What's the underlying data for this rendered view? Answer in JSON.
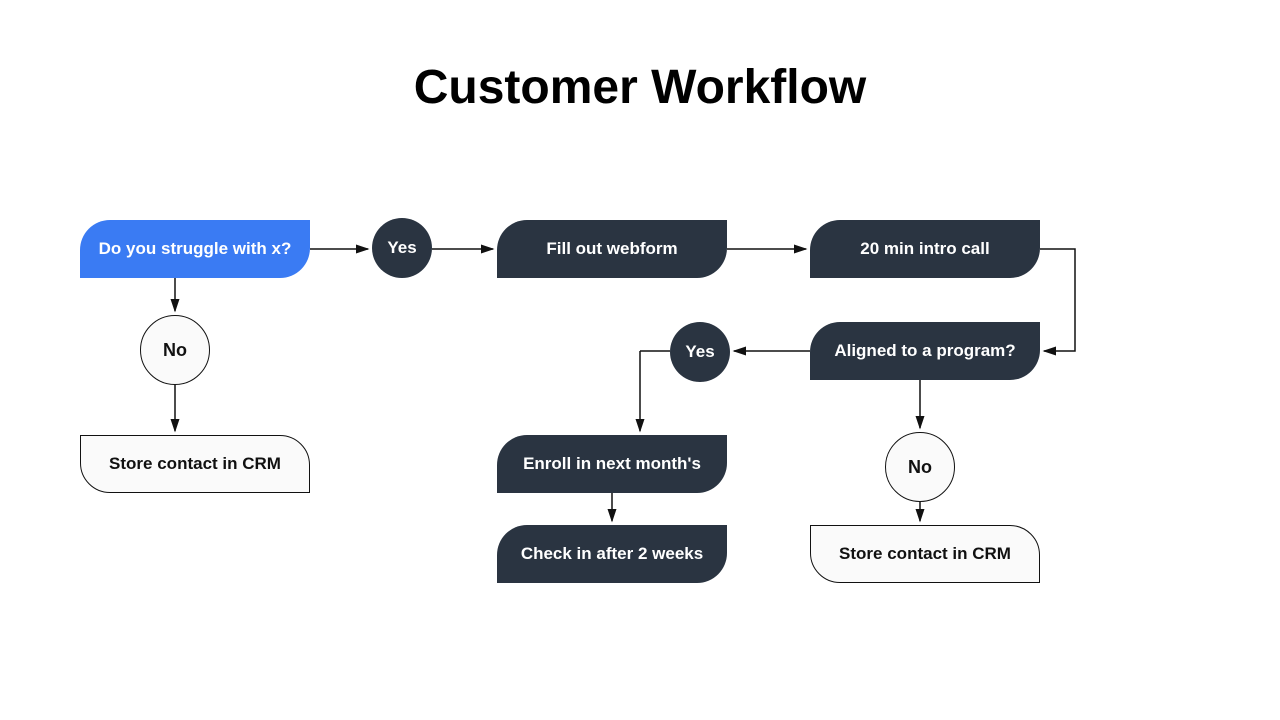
{
  "title": "Customer Workflow",
  "nodes": {
    "start": "Do you struggle with x?",
    "yes1": "Yes",
    "no1": "No",
    "store1": "Store contact in CRM",
    "webform": "Fill out webform",
    "introcall": "20 min intro call",
    "aligned": "Aligned to a program?",
    "yes2": "Yes",
    "no2": "No",
    "enroll": "Enroll in next month's",
    "checkin": "Check in after 2 weeks",
    "store2": "Store contact in CRM"
  }
}
